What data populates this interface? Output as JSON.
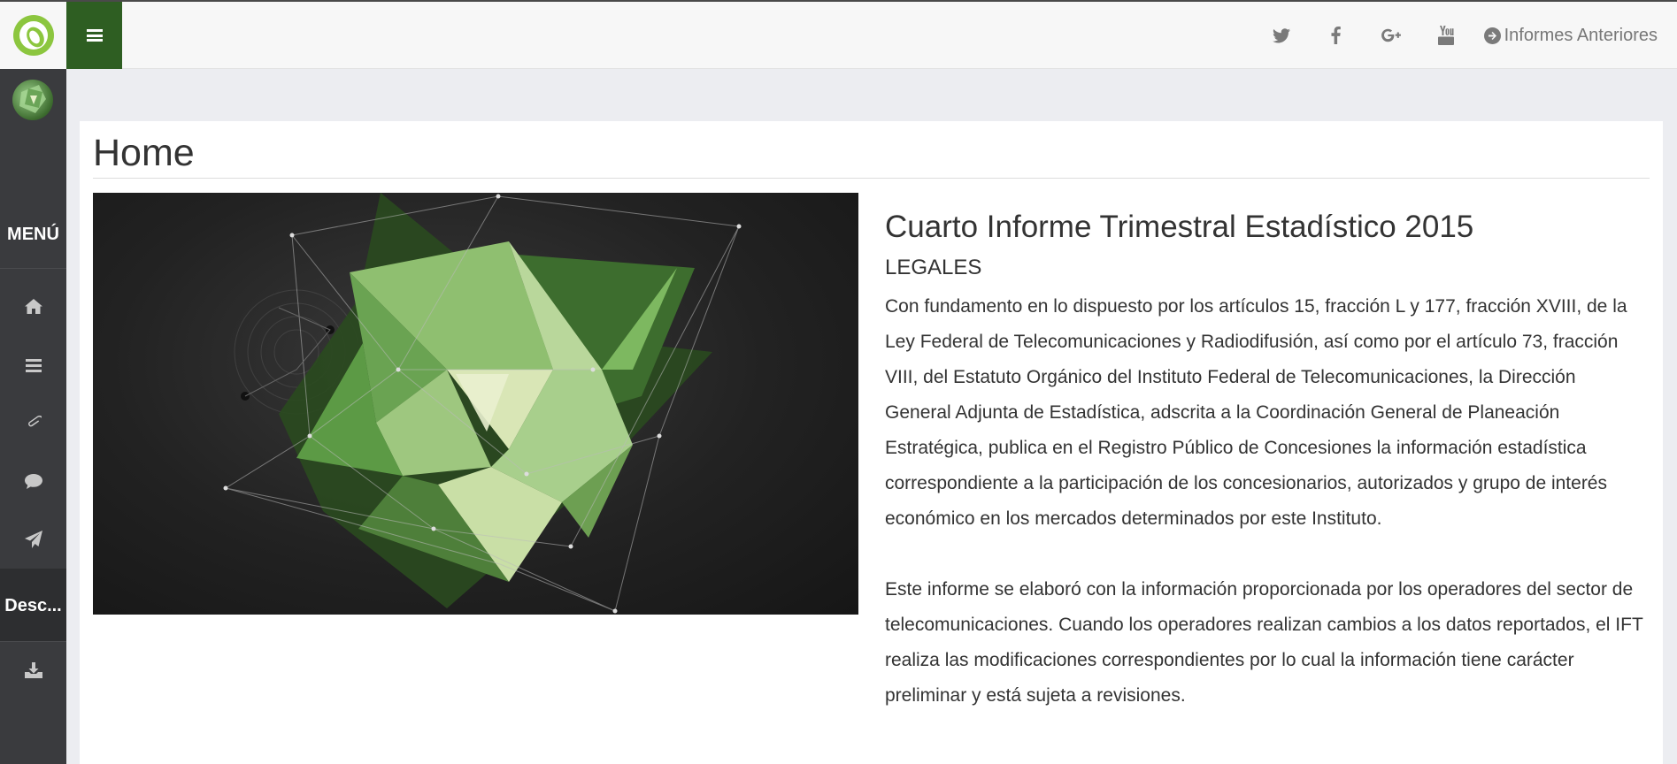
{
  "topbar": {
    "social_icons": [
      "twitter-icon",
      "facebook-icon",
      "google-plus-icon",
      "youtube-icon"
    ],
    "prev_reports_label": "Informes Anteriores"
  },
  "sidebar": {
    "menu_label": "MENÚ",
    "icons": [
      "home-icon",
      "list-icon",
      "paperclip-icon",
      "comment-icon",
      "send-icon"
    ],
    "desc_label": "Desc...",
    "download_icon": "download-icon"
  },
  "main": {
    "page_title": "Home",
    "report_title": "Cuarto Informe Trimestral Estadístico 2015",
    "report_subtitle": "LEGALES",
    "paragraph_1": "Con fundamento en lo dispuesto por los artículos 15, fracción L y 177, fracción XVIII, de la Ley Federal de Telecomunicaciones y Radiodifusión, así como por el artículo 73, fracción VIII, del Estatuto Orgánico del Instituto Federal de Telecomunicaciones, la Dirección General Adjunta de Estadística, adscrita a la Coordinación General de Planeación Estratégica, publica en el Registro Público de Concesiones la información estadística correspondiente a la participación de los concesionarios, autorizados y grupo de interés económico en los mercados determinados por este Instituto.",
    "paragraph_2": "Este informe se elaboró con la información proporcionada por los operadores del sector de telecomunicaciones. Cuando los operadores realizan cambios a los datos reportados, el IFT realiza las modificaciones correspondientes por lo cual la información tiene carácter preliminar y está sujeta a revisiones."
  },
  "colors": {
    "brand_green": "#2e5e22",
    "sidebar_bg": "#3a3b3e"
  }
}
